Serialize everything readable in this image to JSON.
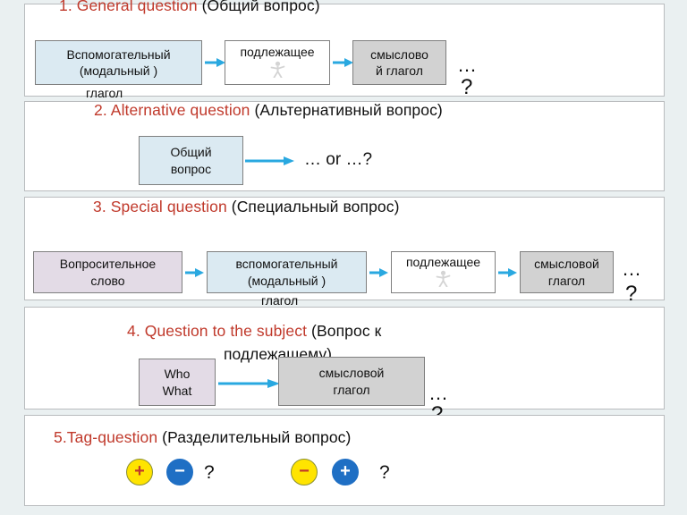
{
  "background_color": "#eaf0f1",
  "accent_color": "#c0392b",
  "arrow_color": "#29a8e0",
  "sections": [
    {
      "id": "general-question",
      "number": "1.",
      "title_en": "General question",
      "title_ru": "(Общий вопрос)",
      "boxes": [
        {
          "name": "auxiliary-modal-verb",
          "line1": "Вспомогательный",
          "line2": "(модальный )",
          "overflow": "глагол",
          "color": "blue"
        },
        {
          "name": "subject",
          "line1": "подлежащее",
          "line2": "",
          "overflow": "",
          "color": "white",
          "icon": "stick-figure-icon"
        },
        {
          "name": "notional-verb",
          "line1": "смыслово",
          "line2": "й глагол",
          "overflow": "",
          "color": "gray"
        }
      ],
      "dots": "…",
      "question_mark": "?"
    },
    {
      "id": "alternative-question",
      "number": "2.",
      "title_en": "Alternative  question",
      "title_ru": "(Альтернативный вопрос)",
      "boxes": [
        {
          "name": "general-question-box",
          "line1": "Общий",
          "line2": "вопрос",
          "overflow": "",
          "color": "blue"
        }
      ],
      "formula": "… or …?"
    },
    {
      "id": "special-question",
      "number": "3.",
      "title_en": "Special question",
      "title_ru": "(Специальный вопрос)",
      "boxes": [
        {
          "name": "question-word",
          "line1": "Вопросительное",
          "line2": "слово",
          "overflow": "",
          "color": "purple"
        },
        {
          "name": "auxiliary-modal-verb",
          "line1": "вспомогательный",
          "line2": "(модальный )",
          "overflow": "глагол",
          "color": "blue"
        },
        {
          "name": "subject",
          "line1": "подлежащее",
          "line2": "",
          "overflow": "",
          "color": "white",
          "icon": "stick-figure-icon"
        },
        {
          "name": "notional-verb",
          "line1": "смысловой",
          "line2": "глагол",
          "overflow": "",
          "color": "gray"
        }
      ],
      "dots": "…",
      "question_mark": "?"
    },
    {
      "id": "question-to-the-subject",
      "number": "4.",
      "title_en": "Question to the subject",
      "title_ru": "(Вопрос к",
      "title_ru_overflow": "подлежащему)",
      "boxes": [
        {
          "name": "who-what",
          "line1": "Who",
          "line2": "What",
          "overflow": "",
          "color": "purple"
        },
        {
          "name": "notional-verb",
          "line1": "смысловой",
          "line2": "глагол",
          "overflow": "",
          "color": "gray"
        }
      ],
      "dots": "…",
      "question_mark": "?"
    },
    {
      "id": "tag-question",
      "number": "5.",
      "title_en": "Tag-question",
      "title_ru": "(Разделительный вопрос)",
      "badge_groups": [
        {
          "first": {
            "sign": "+",
            "color": "yellow"
          },
          "second": {
            "sign": "−",
            "color": "blue"
          },
          "question_mark": "?"
        },
        {
          "first": {
            "sign": "−",
            "color": "yellow"
          },
          "second": {
            "sign": "+",
            "color": "blue"
          },
          "question_mark": "?"
        }
      ]
    }
  ]
}
